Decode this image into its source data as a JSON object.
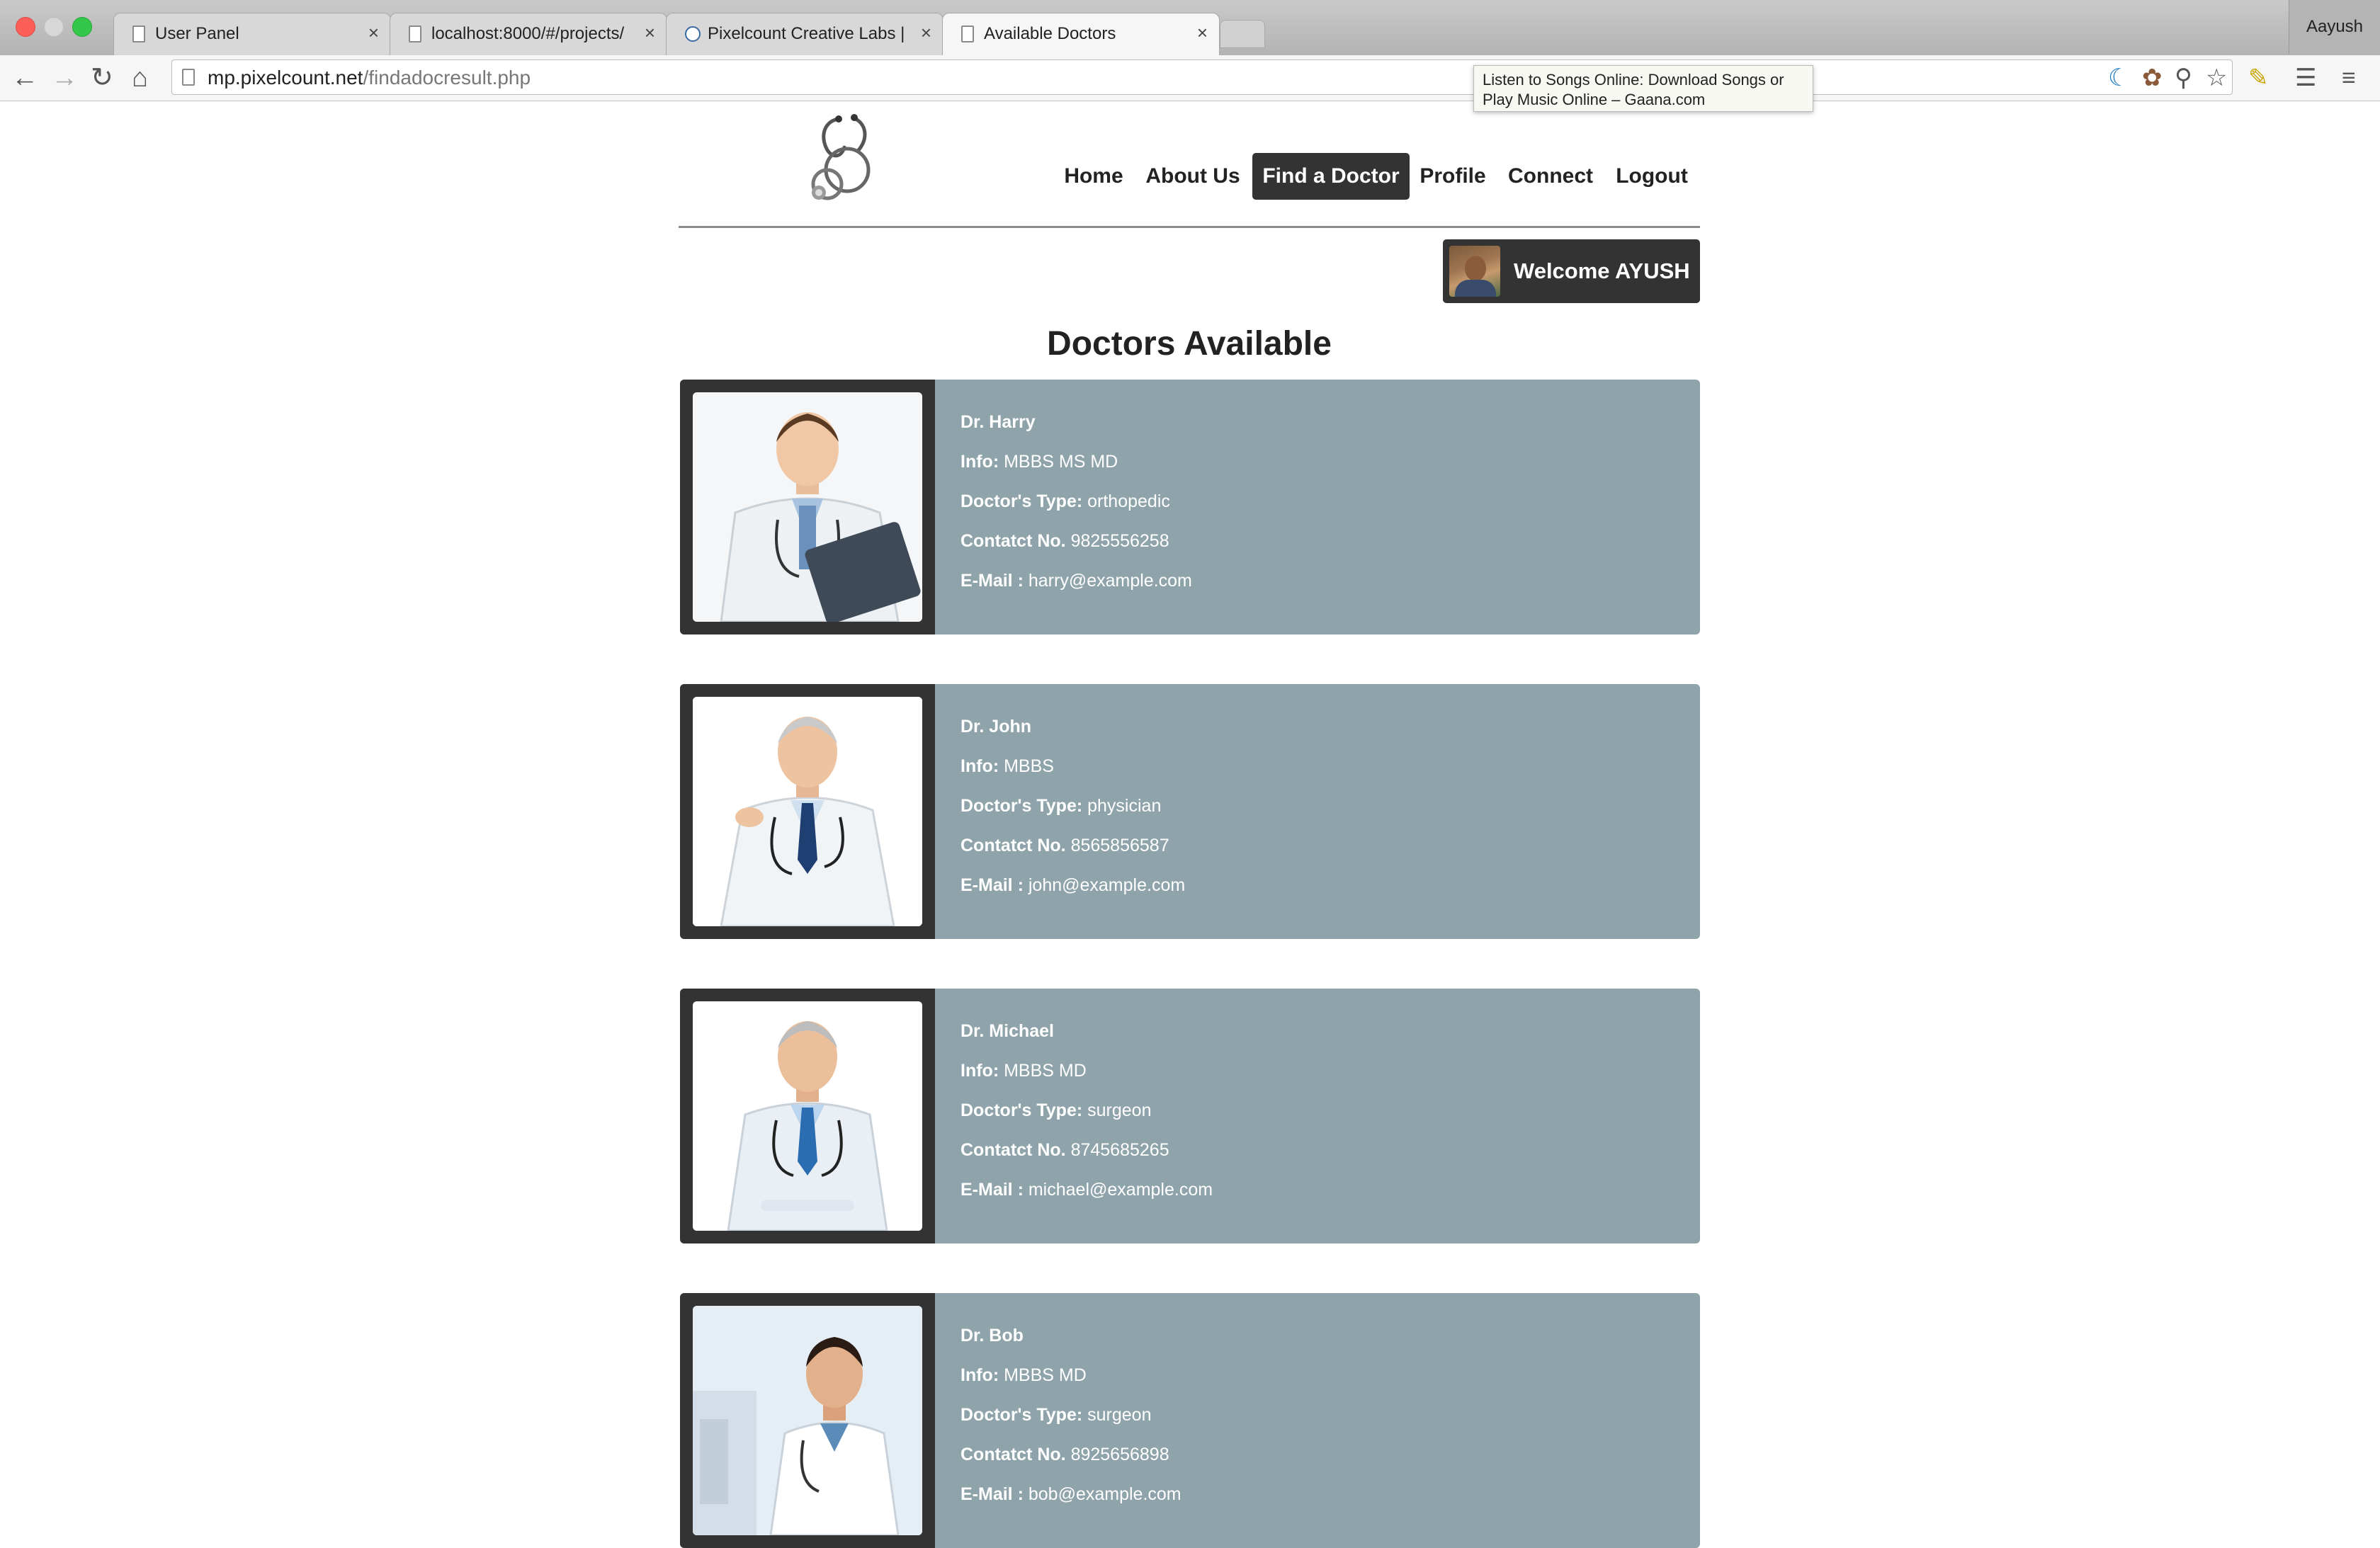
{
  "browser": {
    "tabs": [
      {
        "title": "User Panel",
        "close": "×"
      },
      {
        "title": "localhost:8000/#/projects/",
        "close": "×"
      },
      {
        "title": "Pixelcount Creative Labs | ",
        "close": "×"
      },
      {
        "title": "Available Doctors",
        "close": "×"
      }
    ],
    "profile_name": "Aayush",
    "url_host": "mp.pixelcount.net",
    "url_path": "/findadocresult.php",
    "tooltip": "Listen to Songs Online: Download Songs or Play Music Online – Gaana.com",
    "icons": {
      "back": "←",
      "forward": "→",
      "reload": "↻",
      "home": "⌂",
      "ext1": "☾",
      "ext2": "✿",
      "zoom": "⚲",
      "star": "☆",
      "ext3": "✎",
      "ext4": "☰",
      "menu": "≡"
    }
  },
  "nav": {
    "items": [
      "Home",
      "About Us",
      "Find a Doctor",
      "Profile",
      "Connect",
      "Logout"
    ],
    "active": "Find a Doctor"
  },
  "welcome": {
    "text": "Welcome AYUSH"
  },
  "page_title": "Doctors Available",
  "labels": {
    "info": "Info:",
    "type": "Doctor's Type:",
    "contact": "Contatct No.",
    "email": "E-Mail :"
  },
  "doctors": [
    {
      "name": "Dr. Harry",
      "info": "MBBS MS MD",
      "type": "orthopedic",
      "contact": "9825556258",
      "email": "harry@example.com"
    },
    {
      "name": "Dr. John",
      "info": "MBBS",
      "type": "physician",
      "contact": "8565856587",
      "email": "john@example.com"
    },
    {
      "name": "Dr. Michael",
      "info": "MBBS MD",
      "type": "surgeon",
      "contact": "8745685265",
      "email": "michael@example.com"
    },
    {
      "name": "Dr. Bob",
      "info": "MBBS MD",
      "type": "surgeon",
      "contact": "8925656898",
      "email": "bob@example.com"
    }
  ],
  "colors": {
    "card_bg": "#8fa3aa",
    "frame": "#333333",
    "nav_active": "#333333"
  }
}
